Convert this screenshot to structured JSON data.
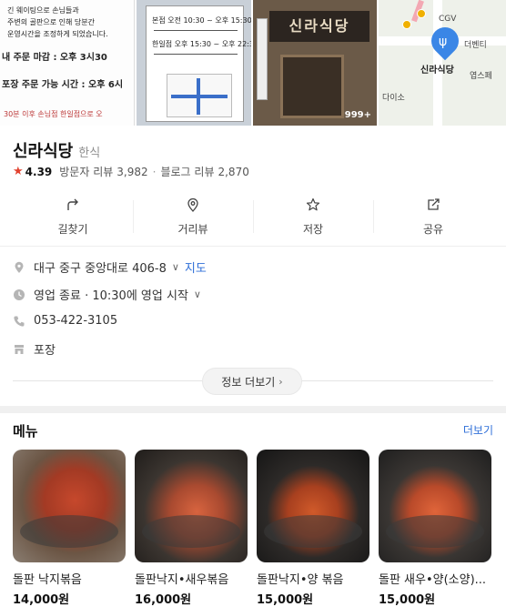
{
  "photos": {
    "sign_lines": [
      "긴 웨이팅으로 손님들과",
      "주변의 골판으로 인해 당분간",
      "운영시간을 조정하게 되었습니다.",
      "내 주문 마감 : 오후 3시30",
      "포장 주문 가능 시간 : 오후 6시",
      "30분 이후 손님점 한일점으로 오"
    ],
    "notice_lines": [
      "본점 오전 10:30 ~ 오후 15:30",
      "한일점 오후 15:30 ~ 오후 22:30"
    ],
    "store_sign": "신라식당",
    "photo_count_badge": "999+",
    "map_labels": [
      "CGV",
      "더벤티",
      "다이소",
      "엽스페",
      "신라식당"
    ],
    "map_pin_icon": "fork-knife-icon"
  },
  "place": {
    "name": "신라식당",
    "category": "한식",
    "rating": "4.39",
    "visitor_reviews_label": "방문자 리뷰",
    "visitor_reviews_count": "3,982",
    "blog_reviews_label": "블로그 리뷰",
    "blog_reviews_count": "2,870"
  },
  "actions": [
    {
      "label": "길찾기",
      "icon": "directions-icon"
    },
    {
      "label": "거리뷰",
      "icon": "street-view-icon"
    },
    {
      "label": "저장",
      "icon": "star-icon"
    },
    {
      "label": "공유",
      "icon": "share-icon"
    }
  ],
  "info": {
    "address": "대구 중구 중앙대로 406-8",
    "map_link": "지도",
    "hours": "영업 종료 · 10:30에 영업 시작",
    "phone": "053-422-3105",
    "takeout": "포장",
    "more_button": "정보 더보기"
  },
  "menu": {
    "heading": "메뉴",
    "more_link": "더보기",
    "items": [
      {
        "name": "돌판 낙지볶음",
        "price": "14,000원"
      },
      {
        "name": "돌판낙지•새우볶음",
        "price": "16,000원"
      },
      {
        "name": "돌판낙지•양 볶음",
        "price": "15,000원"
      },
      {
        "name": "돌판 새우•양(소양)...",
        "price": "15,000원"
      }
    ]
  },
  "colors": {
    "accent_blue": "#2f6fd8",
    "rating_star": "#e2422f"
  }
}
